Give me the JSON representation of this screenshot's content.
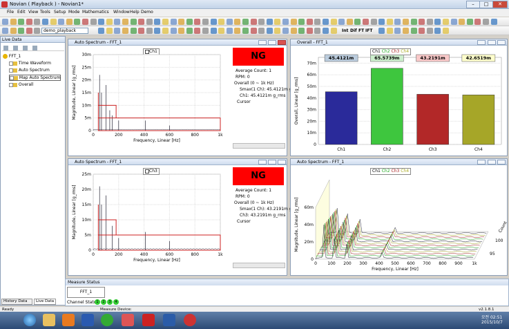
{
  "app": {
    "title": "Novian ( Playback ) - Novian1*"
  },
  "menu": [
    "File",
    "Edit",
    "View",
    "Tools",
    "Setup",
    "Mode",
    "Mathematics",
    "Window",
    "Help",
    "Demo"
  ],
  "toolbar": {
    "playback_dropdown": "demo_playback",
    "math_labels": [
      "Int",
      "Dif",
      "FT",
      "IFT"
    ]
  },
  "left_panel": {
    "title": "Live Data",
    "tree": [
      "FFT_1",
      "Time Waveform",
      "Auto Spectrum",
      "Map Auto Spectrum",
      "Overall"
    ],
    "tabs": [
      "History Data",
      "Live Data"
    ]
  },
  "panels": {
    "top_left": {
      "title": "Auto Spectrum - FFT_1",
      "legend": "Ch1",
      "status": "NG",
      "info": [
        "Average Count: 1",
        "RPM: 0",
        "Overall (0 ~ 1k Hz)",
        "Smax(1 Ch): 45.4121m g_rms",
        "Ch1: 45.4121m g_rms",
        "Cursor"
      ]
    },
    "top_right": {
      "title": "Overall - FFT_1",
      "legend": [
        "Ch1",
        "Ch2",
        "Ch3",
        "Ch4"
      ]
    },
    "bottom_left": {
      "title": "Auto Spectrum - FFT_1",
      "legend": "Ch3",
      "status": "NG",
      "info": [
        "Average Count: 1",
        "RPM: 0",
        "Overall (0 ~ 1k Hz)",
        "Smax(1 Ch): 43.2191m g_rms",
        "Ch3: 43.2191m g_rms",
        "Cursor"
      ]
    },
    "bottom_right": {
      "title": "Auto Spectrum - FFT_1",
      "legend": [
        "Ch1",
        "Ch2",
        "Ch3",
        "Ch4"
      ]
    }
  },
  "chart_data": [
    {
      "type": "line",
      "title": "",
      "xlabel": "Frequency, Linear [Hz]",
      "ylabel": "Magnitude, Linear [g_rms]",
      "xlim": [
        0,
        1000
      ],
      "ylim": [
        0,
        0.03
      ],
      "x_ticks": [
        "0",
        "200",
        "400",
        "600",
        "800",
        "1k"
      ],
      "y_ticks": [
        "0",
        "5m",
        "10m",
        "15m",
        "20m",
        "25m",
        "30m"
      ],
      "peaks": [
        {
          "x": 50,
          "y": 0.022
        },
        {
          "x": 65,
          "y": 0.015
        },
        {
          "x": 100,
          "y": 0.018
        },
        {
          "x": 130,
          "y": 0.008
        },
        {
          "x": 150,
          "y": 0.006
        },
        {
          "x": 200,
          "y": 0.004
        },
        {
          "x": 410,
          "y": 0.004
        },
        {
          "x": 600,
          "y": 0.002
        }
      ],
      "alarm_boxes": [
        {
          "x": [
            40,
            1000
          ],
          "y": [
            0,
            0.005
          ]
        },
        {
          "x": 40,
          "y": [
            0.005,
            0.015
          ]
        },
        {
          "x": [
            40,
            180
          ],
          "y": 0.01
        }
      ]
    },
    {
      "type": "bar",
      "title": "",
      "ylabel": "Overall, Linear [g_rms]",
      "categories": [
        "Ch1",
        "Ch2",
        "Ch3",
        "Ch4"
      ],
      "values": [
        0.0454121,
        0.0655739,
        0.0432191,
        0.0426519
      ],
      "value_labels": [
        "45.4121m",
        "65.5739m",
        "43.2191m",
        "42.6519m"
      ],
      "y_ticks": [
        "0",
        "10m",
        "20m",
        "30m",
        "40m",
        "50m",
        "60m",
        "70m"
      ],
      "ylim": [
        0,
        0.075
      ],
      "colors": [
        "#2a2a9a",
        "#3ec63e",
        "#b22828",
        "#a6a628"
      ]
    },
    {
      "type": "line",
      "title": "",
      "xlabel": "Frequency, Linear [Hz]",
      "ylabel": "Magnitude, Linear [g_rms]",
      "xlim": [
        0,
        1000
      ],
      "ylim": [
        0,
        0.025
      ],
      "x_ticks": [
        "0",
        "200",
        "400",
        "600",
        "800",
        "1k"
      ],
      "y_ticks": [
        "0",
        "5m",
        "10m",
        "15m",
        "20m",
        "25m"
      ],
      "peaks": [
        {
          "x": 50,
          "y": 0.021
        },
        {
          "x": 65,
          "y": 0.015
        },
        {
          "x": 100,
          "y": 0.018
        },
        {
          "x": 150,
          "y": 0.008
        },
        {
          "x": 200,
          "y": 0.004
        },
        {
          "x": 410,
          "y": 0.006
        },
        {
          "x": 600,
          "y": 0.003
        }
      ],
      "alarm_boxes": [
        {
          "x": [
            40,
            1000
          ],
          "y": [
            0,
            0.005
          ]
        },
        {
          "x": 40,
          "y": [
            0.005,
            0.015
          ]
        },
        {
          "x": [
            40,
            180
          ],
          "y": 0.01
        }
      ]
    },
    {
      "type": "area",
      "title": "",
      "xlabel": "Frequency, Linear [Hz]",
      "ylabel": "Magnitude, Linear [g_rms]",
      "zlabel": "Count",
      "x_ticks": [
        "0",
        "100",
        "200",
        "300",
        "400",
        "500",
        "600",
        "700",
        "800",
        "900",
        "1k"
      ],
      "y_ticks": [
        "0",
        "20m",
        "40m",
        "60m"
      ],
      "z_ticks": [
        "95",
        "100"
      ]
    }
  ],
  "measure_status": {
    "title": "Measure Status",
    "tab": "FFT_1",
    "channel_status_label": "Channel Status:",
    "channels": [
      "1",
      "2",
      "3",
      "4"
    ]
  },
  "statusbar": {
    "ready": "Ready",
    "device": "Measure Device:",
    "version": "v2.1.8.1"
  },
  "taskbar": {
    "time": "오전 02:51",
    "date": "2015/10/7"
  }
}
